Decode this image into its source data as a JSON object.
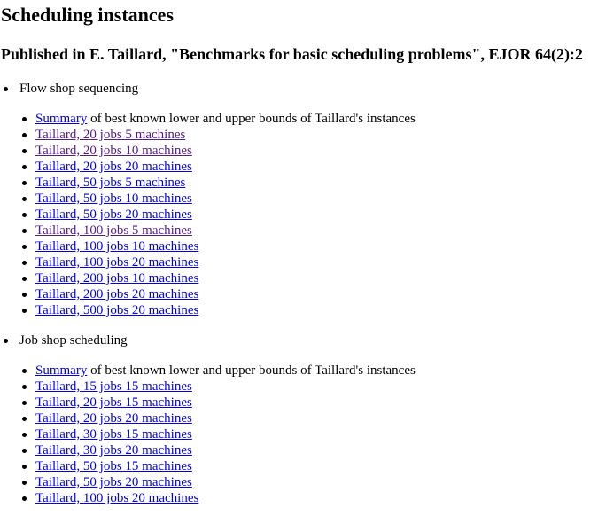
{
  "title": "Scheduling instances",
  "subtitle": "Published in E. Taillard, \"Benchmarks for basic scheduling problems\", EJOR 64(2):2",
  "flow_shop": {
    "heading": "Flow shop sequencing",
    "summary": {
      "link": "Summary",
      "rest": " of best known lower and upper bounds of Taillard's instances"
    },
    "links": [
      {
        "label": "Taillard, 20 jobs 5 machines",
        "visited": true
      },
      {
        "label": "Taillard, 20 jobs 10 machines",
        "visited": true
      },
      {
        "label": "Taillard, 20 jobs 20 machines",
        "visited": false
      },
      {
        "label": "Taillard, 50 jobs 5 machines",
        "visited": false
      },
      {
        "label": "Taillard, 50 jobs 10 machines",
        "visited": false
      },
      {
        "label": "Taillard, 50 jobs 20 machines",
        "visited": false
      },
      {
        "label": "Taillard, 100 jobs 5 machines",
        "visited": true
      },
      {
        "label": "Taillard, 100 jobs 10 machines",
        "visited": false
      },
      {
        "label": "Taillard, 100 jobs 20 machines",
        "visited": false
      },
      {
        "label": "Taillard, 200 jobs 10 machines",
        "visited": false
      },
      {
        "label": "Taillard, 200 jobs 20 machines",
        "visited": false
      },
      {
        "label": "Taillard, 500 jobs 20 machines",
        "visited": false
      }
    ]
  },
  "job_shop": {
    "heading": "Job shop scheduling",
    "summary": {
      "link": "Summary",
      "rest": " of best known lower and upper bounds of Taillard's instances"
    },
    "links": [
      {
        "label": "Taillard, 15 jobs 15 machines",
        "visited": false
      },
      {
        "label": "Taillard, 20 jobs 15 machines",
        "visited": false
      },
      {
        "label": "Taillard, 20 jobs 20 machines",
        "visited": false
      },
      {
        "label": "Taillard, 30 jobs 15 machines",
        "visited": false
      },
      {
        "label": "Taillard, 30 jobs 20 machines",
        "visited": false
      },
      {
        "label": "Taillard, 50 jobs 15 machines",
        "visited": false
      },
      {
        "label": "Taillard, 50 jobs 20 machines",
        "visited": false
      },
      {
        "label": "Taillard, 100 jobs 20 machines",
        "visited": false
      }
    ]
  }
}
